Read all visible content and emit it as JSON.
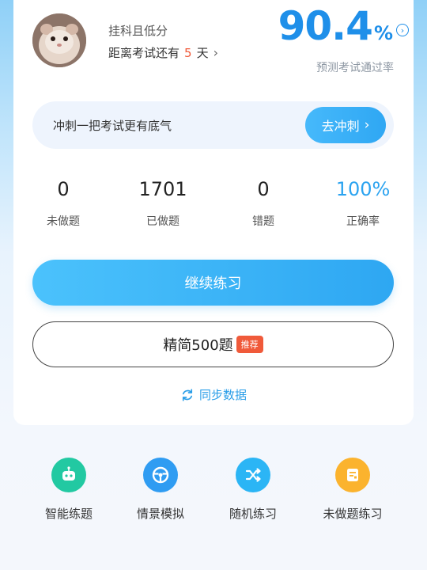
{
  "profile": {
    "status_text": "挂科且低分",
    "countdown_prefix": "距离考试还有",
    "countdown_days": "5",
    "countdown_unit": "天",
    "chevron": "›"
  },
  "pass_rate": {
    "value": "90.4",
    "percent_sign": "%",
    "label": "预测考试通过率",
    "info_glyph": "›"
  },
  "sprint": {
    "text": "冲刺一把考试更有底气",
    "button_label": "去冲刺",
    "chevron": "›"
  },
  "stats": [
    {
      "value": "0",
      "label": "未做题"
    },
    {
      "value": "1701",
      "label": "已做题"
    },
    {
      "value": "0",
      "label": "错题"
    },
    {
      "value": "100%",
      "label": "正确率"
    }
  ],
  "continue_label": "继续练习",
  "slim": {
    "label": "精简500题",
    "badge": "推荐"
  },
  "sync_label": "同步数据",
  "bottom_nav": [
    {
      "label": "智能练题",
      "icon": "robot-icon",
      "color": "#22c9a2"
    },
    {
      "label": "情景模拟",
      "icon": "steering-wheel-icon",
      "color": "#2f9cf2"
    },
    {
      "label": "随机练习",
      "icon": "shuffle-icon",
      "color": "#2bb5f5"
    },
    {
      "label": "未做题练习",
      "icon": "document-icon",
      "color": "#fbb32e"
    }
  ],
  "colors": {
    "accent": "#1f8fe9",
    "highlight": "#f05a3a",
    "primary_button": "#3fb5f7"
  }
}
